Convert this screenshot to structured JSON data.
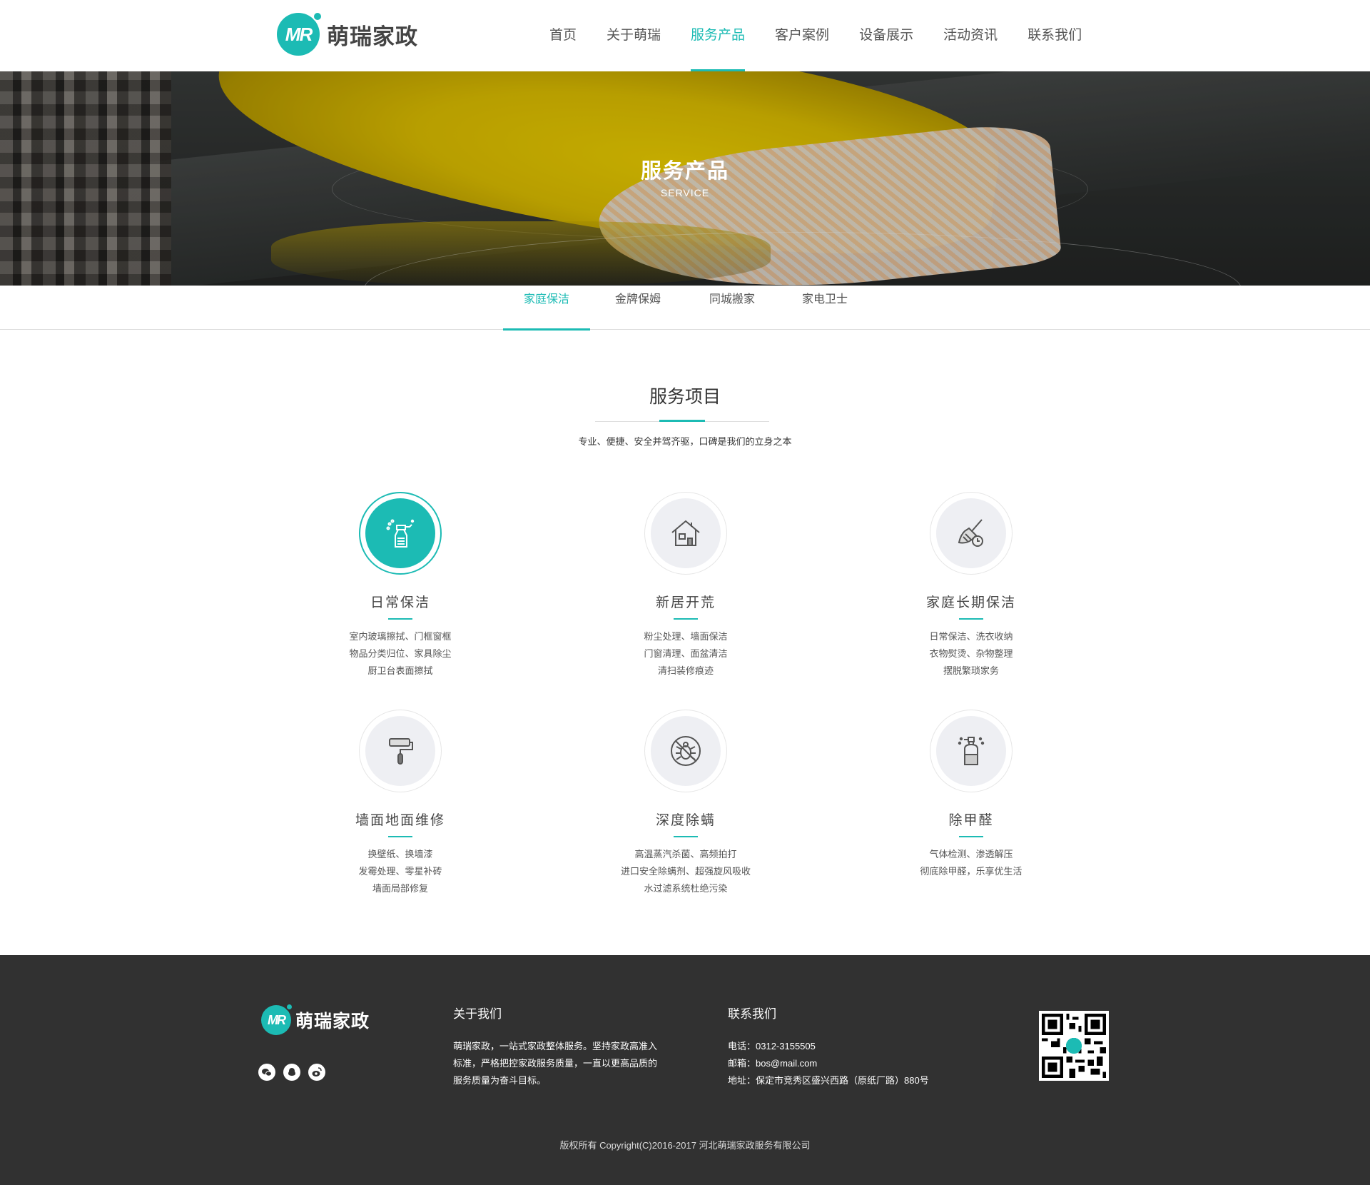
{
  "brand": {
    "logo_mark": "MR",
    "name": "萌瑞家政",
    "accent_color": "#1cbbb4"
  },
  "nav": {
    "items": [
      {
        "label": "首页"
      },
      {
        "label": "关于萌瑞"
      },
      {
        "label": "服务产品",
        "active": true
      },
      {
        "label": "客户案例"
      },
      {
        "label": "设备展示"
      },
      {
        "label": "活动资讯"
      },
      {
        "label": "联系我们"
      }
    ]
  },
  "banner": {
    "title": "服务产品",
    "subtitle": "SERVICE"
  },
  "subtabs": [
    {
      "label": "家庭保洁",
      "active": true
    },
    {
      "label": "金牌保姆"
    },
    {
      "label": "同城搬家"
    },
    {
      "label": "家电卫士"
    }
  ],
  "section": {
    "title": "服务项目",
    "description": "专业、便捷、安全并驾齐驱，口碑是我们的立身之本"
  },
  "services": [
    {
      "name": "日常保洁",
      "icon": "spray-bottle-icon",
      "active": true,
      "lines": [
        "室内玻璃擦拭、门框窗框",
        "物品分类归位、家具除尘",
        "厨卫台表面擦拭"
      ]
    },
    {
      "name": "新居开荒",
      "icon": "house-icon",
      "lines": [
        "粉尘处理、墙面保洁",
        "门窗清理、面盆清洁",
        "清扫装修痕迹"
      ]
    },
    {
      "name": "家庭长期保洁",
      "icon": "broom-clock-icon",
      "lines": [
        "日常保洁、洗衣收纳",
        "衣物熨烫、杂物整理",
        "摆脱繁琐家务"
      ]
    },
    {
      "name": "墙面地面维修",
      "icon": "paint-roller-icon",
      "lines": [
        "换壁纸、换墙漆",
        "发霉处理、零星补砖",
        "墙面局部修复"
      ]
    },
    {
      "name": "深度除螨",
      "icon": "no-mites-icon",
      "lines": [
        "高温蒸汽杀菌、高频拍打",
        "进口安全除螨剂、超强旋风吸收",
        "水过滤系统杜绝污染"
      ]
    },
    {
      "name": "除甲醛",
      "icon": "spray-canister-icon",
      "lines": [
        "气体检测、渗透解压",
        "彻底除甲醛，乐享优生活"
      ]
    }
  ],
  "footer": {
    "about_title": "关于我们",
    "about_text": [
      "萌瑞家政，一站式家政整体服务。坚持家政高准入",
      "标准，严格把控家政服务质量，一直以更高品质的",
      "服务质量为奋斗目标。"
    ],
    "contact_title": "联系我们",
    "contact": [
      "电话：0312-3155505",
      "邮箱：bos@mail.com",
      "地址：保定市竞秀区盛兴西路（原纸厂路）880号"
    ],
    "social_icons": [
      "wechat-icon",
      "qq-icon",
      "weibo-icon"
    ],
    "copyright": "版权所有 Copyright(C)2016-2017 河北萌瑞家政服务有限公司"
  }
}
